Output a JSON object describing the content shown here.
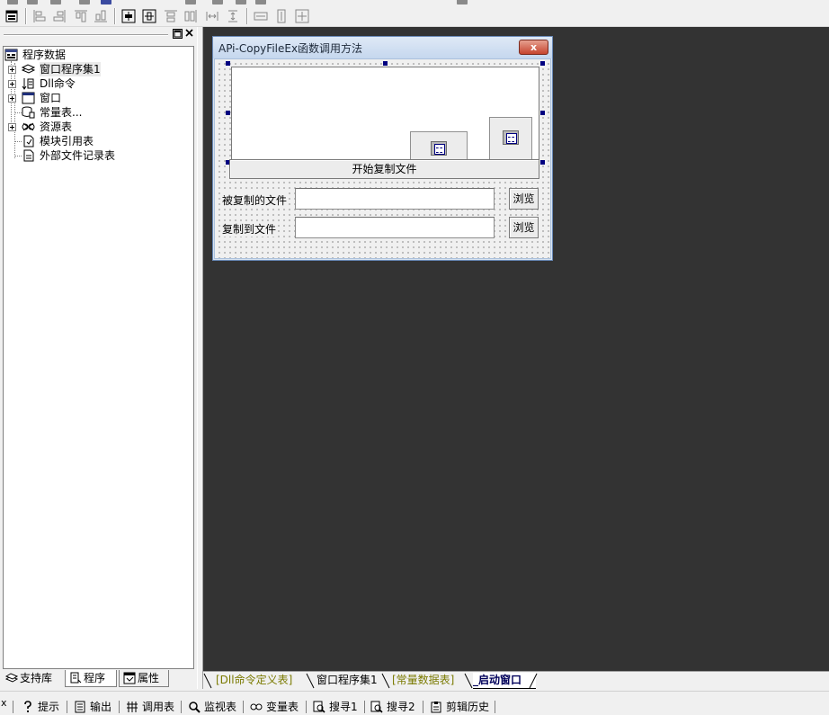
{
  "toolbar": {
    "icons": [
      "form-icon",
      "align-left-icon",
      "align-center-icon",
      "align-top-icon",
      "align-bottom-icon",
      "center-horizontal-icon",
      "center-vertical-icon",
      "distribute-top-icon",
      "distribute-right-icon",
      "space-horizontal-icon",
      "space-vertical-icon",
      "same-width-icon",
      "same-height-icon",
      "same-size-icon"
    ]
  },
  "tree": {
    "root": "程序数据",
    "items": [
      {
        "label": "窗口程序集1",
        "expandable": true,
        "icon": "layers-icon"
      },
      {
        "label": "Dll命令",
        "expandable": true,
        "icon": "sort-list-icon"
      },
      {
        "label": "窗口",
        "expandable": true,
        "icon": "window-icon"
      },
      {
        "label": "常量表...",
        "expandable": false,
        "icon": "database-icon"
      },
      {
        "label": "资源表",
        "expandable": true,
        "icon": "resources-icon"
      },
      {
        "label": "模块引用表",
        "expandable": false,
        "icon": "module-icon"
      },
      {
        "label": "外部文件记录表",
        "expandable": false,
        "icon": "file-list-icon"
      }
    ]
  },
  "left_tabs": [
    "支持库",
    "程序",
    "属性"
  ],
  "form": {
    "title": "APi-CopyFileEx函数调用方法",
    "close_glyph": "x",
    "copy_button": "开始复制文件",
    "source_label": "被复制的文件",
    "target_label": "复制到文件",
    "browse1": "浏览",
    "browse2": "浏览",
    "source_value": "",
    "target_value": ""
  },
  "doc_tabs": [
    "[Dll命令定义表]",
    "窗口程序集1",
    "[常量数据表]",
    "_启动窗口"
  ],
  "doc_tab_colors": {
    "bracket": "#7a7a00",
    "normal": "#000000",
    "active": "#00005a"
  },
  "bottom": {
    "close_glyph": "x",
    "items": [
      "提示",
      "输出",
      "调用表",
      "监视表",
      "变量表",
      "搜寻1",
      "搜寻2",
      "剪辑历史"
    ]
  }
}
